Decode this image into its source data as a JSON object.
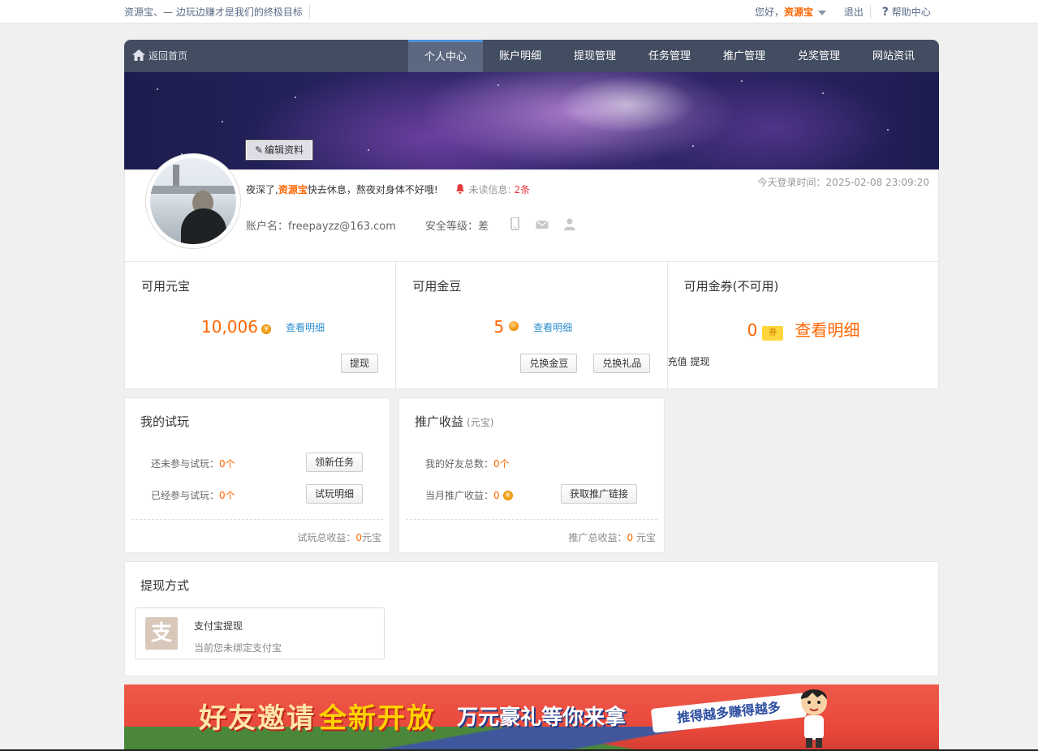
{
  "topbar": {
    "slogan": "资源宝、— 边玩边赚才是我们的终极目标",
    "greet_prefix": "您好，",
    "greet_name": "资源宝",
    "logout": "退出",
    "help": "帮助中心"
  },
  "nav": {
    "home": "返回首页",
    "tabs": [
      {
        "label": "个人中心",
        "active": true
      },
      {
        "label": "账户明细"
      },
      {
        "label": "提现管理"
      },
      {
        "label": "任务管理"
      },
      {
        "label": "推广管理"
      },
      {
        "label": "兑奖管理"
      },
      {
        "label": "网站资讯"
      }
    ]
  },
  "profile": {
    "edit_button": "编辑资料",
    "greeting_prefix": "夜深了,",
    "greeting_brand": "资源宝",
    "greeting_suffix": "快去休息，熬夜对身体不好哦!",
    "unread_label": "未读信息:",
    "unread_count": "2条",
    "login_time": "今天登录时间：2025-02-08 23:09:20",
    "account_label": "账户名：",
    "account_value": "freepayzz@163.com",
    "security_label": "安全等级：",
    "security_value": "差"
  },
  "stats": {
    "yuanbao": {
      "title": "可用元宝",
      "value": "10,006",
      "detail": "查看明细",
      "withdraw": "提现"
    },
    "jindou": {
      "title": "可用金豆",
      "value": "5",
      "detail": "查看明细",
      "exchange_beans": "兑换金豆",
      "exchange_gifts": "兑换礼品"
    },
    "coupon": {
      "title": "可用金券(不可用)",
      "value": "0",
      "coupon_label": "券",
      "detail": "查看明细",
      "recharge": "充值",
      "withdraw": "提现"
    }
  },
  "trial": {
    "title": "我的试玩",
    "not_joined_label": "还未参与试玩：",
    "not_joined_value": "0个",
    "new_task": "领新任务",
    "joined_label": "已经参与试玩：",
    "joined_value": "0个",
    "trial_detail": "试玩明细",
    "total_label": "试玩总收益：",
    "total_value": "0",
    "total_unit": "元宝"
  },
  "promo_income": {
    "title": "推广收益",
    "unit": "(元宝)",
    "friends_label": "我的好友总数：",
    "friends_value": "0个",
    "month_label": "当月推广收益：",
    "month_value": "0",
    "get_link": "获取推广链接",
    "total_label": "推广总收益：",
    "total_value": "0",
    "total_unit": " 元宝"
  },
  "withdraw": {
    "title": "提现方式",
    "alipay_title": "支付宝提现",
    "alipay_sub": "当前您未绑定支付宝",
    "alipay_icon_char": "支"
  },
  "promo_banner": {
    "text1": "好友邀请",
    "text2": "全新开放",
    "text3": "万元豪礼等你来拿",
    "text4": "推得越多赚得越多"
  },
  "colors": {
    "accent": "#ff6600",
    "nav_bg": "#434d61",
    "link": "#2d8ecf",
    "alert": "#e4393c"
  }
}
